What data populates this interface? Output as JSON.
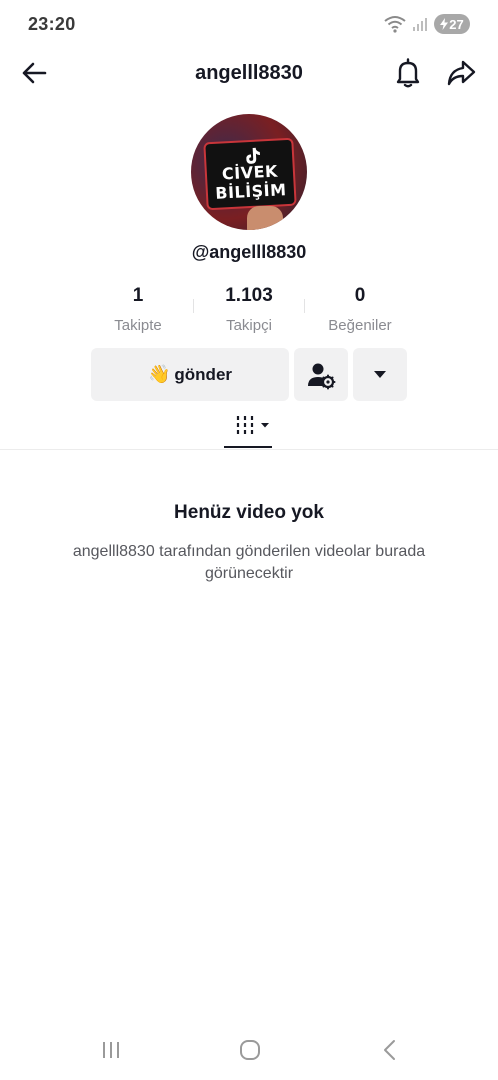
{
  "status_bar": {
    "time": "23:20",
    "battery": "27",
    "icons": [
      "wifi-icon",
      "signal-icon",
      "battery-icon"
    ]
  },
  "header": {
    "title": "angelll8830",
    "icons": [
      "back-arrow-icon",
      "bell-icon",
      "share-icon"
    ]
  },
  "profile": {
    "avatar_text_line1": "CİVEK",
    "avatar_text_line2": "BİLİŞİM",
    "handle": "@angelll8830",
    "stats": [
      {
        "value": "1",
        "label": "Takipte"
      },
      {
        "value": "1.103",
        "label": "Takipçi"
      },
      {
        "value": "0",
        "label": "Beğeniler"
      }
    ]
  },
  "actions": {
    "send_emoji": "👋",
    "send_label": "gönder",
    "icons": [
      "user-settings-icon",
      "dropdown-caret-icon"
    ]
  },
  "tabs": {
    "icons": [
      "videos-grid-icon"
    ]
  },
  "empty_state": {
    "title": "Henüz video yok",
    "description": "angelll8830 tarafından gönderilen videolar burada görünecektir"
  },
  "system_nav": {
    "icons": [
      "recent-apps-icon",
      "home-icon",
      "back-icon"
    ]
  },
  "colors": {
    "text_primary": "#161823",
    "text_secondary": "#8a8b91",
    "button_bg": "#f1f1f2",
    "battery_bg": "#a8a8a8"
  }
}
